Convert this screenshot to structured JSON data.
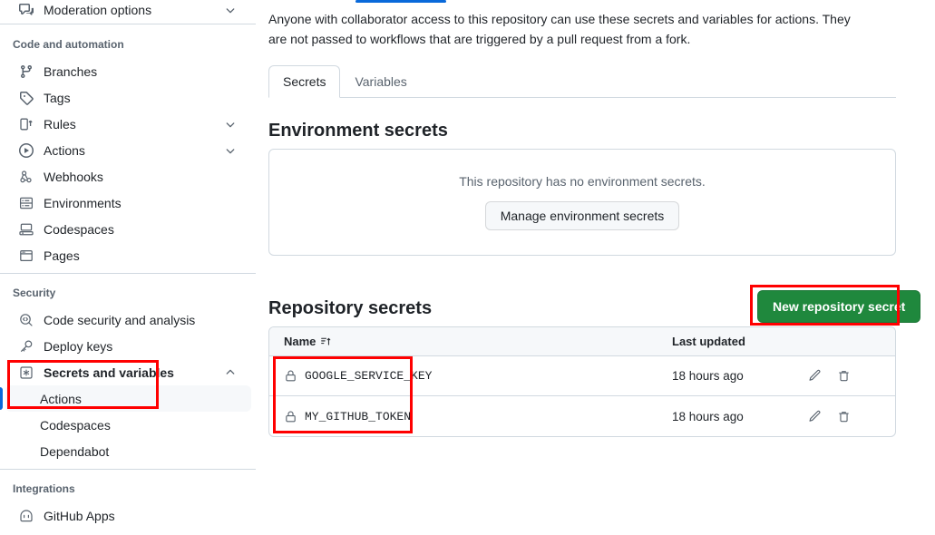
{
  "sidebar": {
    "top_item": {
      "label": "Moderation options",
      "icon": "comment-discussion-icon",
      "chevron": "chevron-down-icon"
    },
    "sections": [
      {
        "title": "Code and automation",
        "items": [
          {
            "label": "Branches",
            "icon": "git-branch-icon",
            "chevron": ""
          },
          {
            "label": "Tags",
            "icon": "tag-icon",
            "chevron": ""
          },
          {
            "label": "Rules",
            "icon": "rules-icon",
            "chevron": "chevron-down-icon"
          },
          {
            "label": "Actions",
            "icon": "play-circle-icon",
            "chevron": "chevron-down-icon"
          },
          {
            "label": "Webhooks",
            "icon": "webhook-icon",
            "chevron": ""
          },
          {
            "label": "Environments",
            "icon": "server-icon",
            "chevron": ""
          },
          {
            "label": "Codespaces",
            "icon": "codespaces-icon",
            "chevron": ""
          },
          {
            "label": "Pages",
            "icon": "browser-icon",
            "chevron": ""
          }
        ]
      },
      {
        "title": "Security",
        "items": [
          {
            "label": "Code security and analysis",
            "icon": "code-search-icon",
            "chevron": ""
          },
          {
            "label": "Deploy keys",
            "icon": "key-icon",
            "chevron": ""
          },
          {
            "label": "Secrets and variables",
            "icon": "asterisk-box-icon",
            "chevron": "chevron-up-icon",
            "bold": true
          }
        ],
        "sub_items": [
          {
            "label": "Actions",
            "active": true
          },
          {
            "label": "Codespaces",
            "active": false
          },
          {
            "label": "Dependabot",
            "active": false
          }
        ]
      },
      {
        "title": "Integrations",
        "items": [
          {
            "label": "GitHub Apps",
            "icon": "github-apps-icon",
            "chevron": ""
          }
        ]
      }
    ]
  },
  "main": {
    "description": "Anyone with collaborator access to this repository can use these secrets and variables for actions. They are not passed to workflows that are triggered by a pull request from a fork.",
    "tabs": [
      {
        "label": "Secrets",
        "active": true
      },
      {
        "label": "Variables",
        "active": false
      }
    ],
    "environment_secrets": {
      "title": "Environment secrets",
      "empty_text": "This repository has no environment secrets.",
      "manage_button": "Manage environment secrets"
    },
    "repository_secrets": {
      "title": "Repository secrets",
      "new_button": "New repository secret",
      "columns": {
        "name": "Name",
        "sort_icon": "sort-asc-icon",
        "last_updated": "Last updated"
      },
      "rows": [
        {
          "icon": "lock-icon",
          "name": "GOOGLE_SERVICE_KEY",
          "last_updated": "18 hours ago",
          "edit_icon": "pencil-icon",
          "delete_icon": "trash-icon"
        },
        {
          "icon": "lock-icon",
          "name": "MY_GITHUB_TOKEN",
          "last_updated": "18 hours ago",
          "edit_icon": "pencil-icon",
          "delete_icon": "trash-icon"
        }
      ]
    }
  },
  "annotations": {
    "highlight_color": "#ff0000",
    "boxes": [
      {
        "name": "secrets-and-variables-nav"
      },
      {
        "name": "new-repository-secret-button"
      },
      {
        "name": "secret-names-column"
      }
    ]
  },
  "colors": {
    "accent_blue": "#0969da",
    "success_green": "#1f883d",
    "border": "#d1d9e0",
    "muted_text": "#59636e"
  }
}
